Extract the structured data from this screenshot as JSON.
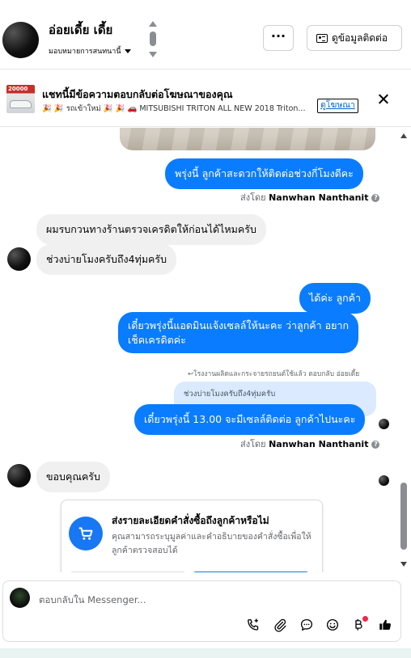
{
  "header": {
    "name": "อ่อยเดี้ย เดี้ย",
    "assign": "มอบหมายการสนทนานี้",
    "more_label": "···",
    "info_label": "ดูข้อมูลติดต่อ"
  },
  "ad_banner": {
    "thumb_text": "20000",
    "title": "แชทนี้มีข้อความตอบกลับต่อโฆษณาของคุณ",
    "description": "🎉 🎉 รถเข้าใหม่ 🎉 🎉 🚗 MITSUBISHI TRITON ALL NEW 2018 Triton...",
    "link_label": "ดูโฆษณา"
  },
  "messages": [
    {
      "side": "out",
      "text": "พรุ่งนี้ ลูกค้าสะดวกให้ติดต่อช่วงกี่โมงดีคะ"
    },
    {
      "side": "in",
      "text": "ผมรบกวนทางร้านตรวจเครดิตให้ก่อนได้ไหมครับ"
    },
    {
      "side": "in",
      "text": "ช่วงบ่ายโมงครับถึง4ทุ่มครับ"
    },
    {
      "side": "out",
      "text": "ได้ค่ะ  ลูกค้า"
    },
    {
      "side": "out",
      "line1": "เดี๋ยวพรุ่งนี้แอดมินแจ้งเซลล์ให้นะคะ  ว่าลูกค้า อยาก",
      "line2": "เช็คเครดิตค่ะ"
    },
    {
      "side": "out",
      "text": "เดี๋ยวพรุ่งนี้ 13.00 จะมีเซลล์ติดต่อ ลูกค้าไปนะคะ"
    },
    {
      "side": "in",
      "text": "ขอบคุณครับ"
    }
  ],
  "sent_by": {
    "prefix": "ส่งโดย",
    "name": "Nanwhan Nanthanit"
  },
  "reply_note": "↩โรงงานผลิตและกระจายรถยนต์ใช้แล้ว ตอบกลับ อ่อยเดี้ย",
  "quoted_text": "ช่วงบ่ายโมงครับถึง4ทุ่มครับ",
  "order_card": {
    "title": "ส่งรายละเอียดคำสั่งซื้อถึงลูกค้าหรือไม่",
    "description": "คุณสามารถระบุมูลค่าและคำอธิบายของคำสั่งซื้อเพื่อให้ลูกค้าตรวจสอบได้"
  },
  "composer": {
    "placeholder": "ตอบกลับใน Messenger..."
  },
  "icons": {
    "call_add": "phone-plus-icon",
    "attach": "paperclip-icon",
    "saved_reply": "chat-bubble-icon",
    "emoji": "emoji-icon",
    "payment": "baht-icon",
    "like": "thumbs-up-icon"
  },
  "colors": {
    "outgoing_bubble": "#0a7cff",
    "incoming_bubble": "#f0f0f0",
    "primary_button": "#1877f2",
    "notification_dot": "#f02849"
  }
}
